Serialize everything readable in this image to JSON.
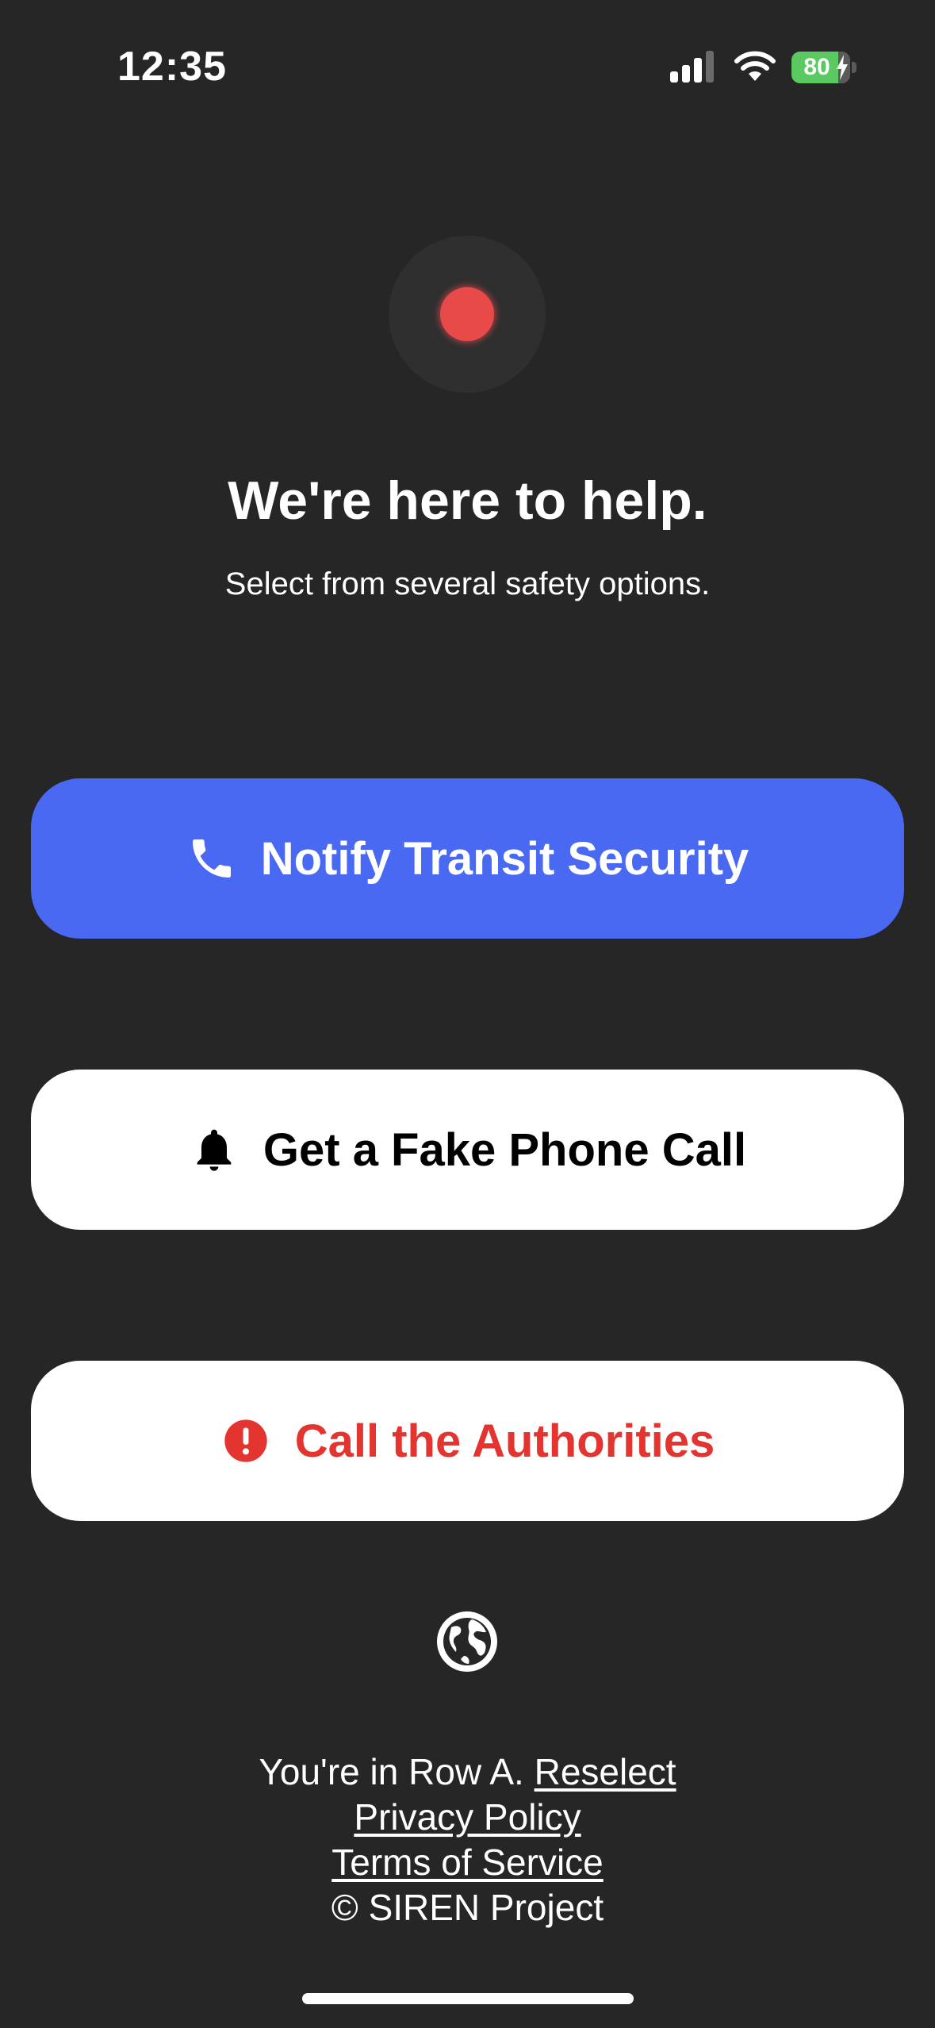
{
  "status_bar": {
    "time": "12:35",
    "battery_percent": "80",
    "battery_level": 0.8,
    "icons": [
      "signal-icon",
      "wifi-icon",
      "battery-charging-icon"
    ]
  },
  "record_indicator": {
    "icon": "recording-dot-icon",
    "color": "#e84a4a"
  },
  "header": {
    "title": "We're here to help.",
    "subtitle": "Select from several safety options."
  },
  "actions": [
    {
      "label": "Notify Transit Security",
      "icon": "phone-icon",
      "background": "#4a69f2",
      "text_color": "#ffffff"
    },
    {
      "label": "Get a Fake Phone Call",
      "icon": "bell-icon",
      "background": "#ffffff",
      "text_color": "#000000"
    },
    {
      "label": "Call the Authorities",
      "icon": "alert-icon",
      "background": "#ffffff",
      "text_color": "#e3342f"
    }
  ],
  "language": {
    "icon": "globe-icon"
  },
  "footer": {
    "location_text": "You're in Row A.",
    "reselect_link": "Reselect",
    "privacy_link": "Privacy Policy",
    "terms_link": "Terms of Service",
    "copyright": "© SIREN Project"
  },
  "colors": {
    "background": "#262626",
    "accent": "#4a69f2",
    "danger": "#e3342f"
  }
}
